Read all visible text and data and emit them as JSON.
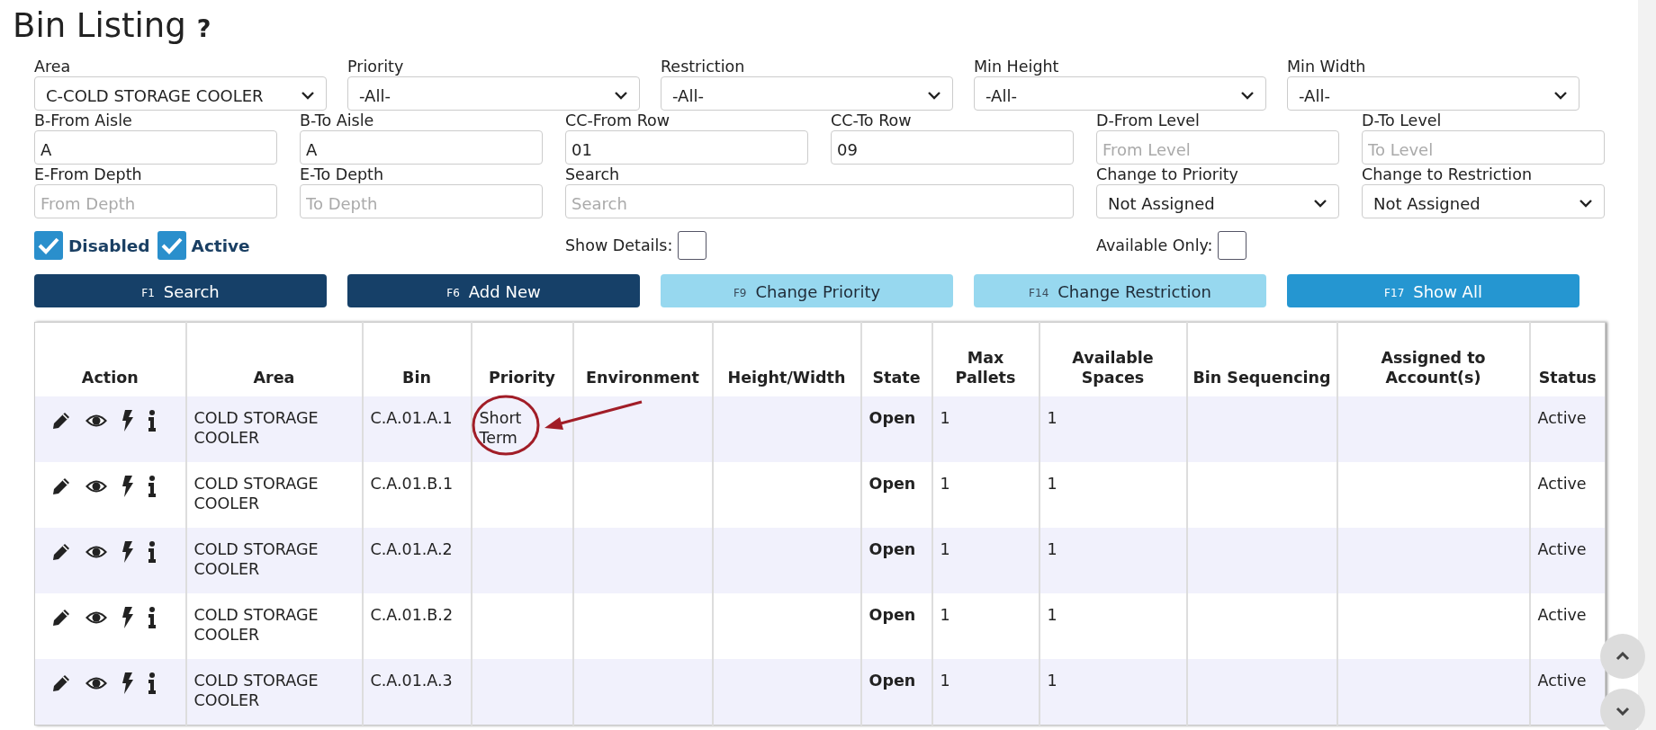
{
  "page": {
    "title": "Bin Listing",
    "help": "?"
  },
  "filters": {
    "selects": [
      {
        "label": "Area",
        "value": "C-COLD STORAGE COOLER"
      },
      {
        "label": "Priority",
        "value": "-All-"
      },
      {
        "label": "Restriction",
        "value": "-All-"
      },
      {
        "label": "Min Height",
        "value": "-All-"
      },
      {
        "label": "Min Width",
        "value": "-All-"
      }
    ],
    "fields": [
      {
        "kind": "input",
        "label": "B-From Aisle",
        "value": "A"
      },
      {
        "kind": "input",
        "label": "B-To Aisle",
        "value": "A"
      },
      {
        "kind": "input",
        "label": "CC-From Row",
        "value": "01"
      },
      {
        "kind": "input",
        "label": "CC-To Row",
        "value": "09"
      },
      {
        "kind": "input",
        "label": "D-From Level",
        "placeholder": "From Level"
      },
      {
        "kind": "input",
        "label": "D-To Level",
        "placeholder": "To Level"
      },
      {
        "kind": "input",
        "label": "E-From Depth",
        "placeholder": "From Depth"
      },
      {
        "kind": "input",
        "label": "E-To Depth",
        "placeholder": "To Depth"
      },
      {
        "kind": "wide-input",
        "label": "Search",
        "placeholder": "Search"
      },
      {
        "kind": "select",
        "label": "Change to Priority",
        "value": "Not Assigned"
      },
      {
        "kind": "select",
        "label": "Change to Restriction",
        "value": "Not Assigned"
      }
    ],
    "checkboxes": [
      {
        "label": "Disabled",
        "checked": true
      },
      {
        "label": "Active",
        "checked": true
      }
    ],
    "show_details": {
      "label": "Show Details:",
      "checked": false
    },
    "available_only": {
      "label": "Available Only:",
      "checked": false
    }
  },
  "buttons": [
    {
      "key": "F1",
      "label": "Search",
      "kind": "dark"
    },
    {
      "key": "F6",
      "label": "Add New",
      "kind": "dark"
    },
    {
      "key": "F9",
      "label": "Change Priority",
      "kind": "light"
    },
    {
      "key": "F14",
      "label": "Change Restriction",
      "kind": "light"
    },
    {
      "key": "F17",
      "label": "Show All",
      "kind": "bright"
    }
  ],
  "table": {
    "columns": [
      "Action",
      "Area",
      "Bin",
      "Priority",
      "Environment",
      "Height/Width",
      "State",
      "Max Pallets",
      "Available Spaces",
      "Bin Sequencing",
      "Assigned to Account(s)",
      "Status"
    ],
    "rows": [
      {
        "area": "COLD STORAGE COOLER",
        "bin": "C.A.01.A.1",
        "priority": "Short Term",
        "priority_circled": true,
        "state": "Open",
        "max_pallets": "1",
        "available_spaces": "1",
        "status": "Active"
      },
      {
        "area": "COLD STORAGE COOLER",
        "bin": "C.A.01.B.1",
        "state": "Open",
        "max_pallets": "1",
        "available_spaces": "1",
        "status": "Active"
      },
      {
        "area": "COLD STORAGE COOLER",
        "bin": "C.A.01.A.2",
        "state": "Open",
        "max_pallets": "1",
        "available_spaces": "1",
        "status": "Active"
      },
      {
        "area": "COLD STORAGE COOLER",
        "bin": "C.A.01.B.2",
        "state": "Open",
        "max_pallets": "1",
        "available_spaces": "1",
        "status": "Active"
      },
      {
        "area": "COLD STORAGE COOLER",
        "bin": "C.A.01.A.3",
        "state": "Open",
        "max_pallets": "1",
        "available_spaces": "1",
        "status": "Active"
      }
    ]
  }
}
